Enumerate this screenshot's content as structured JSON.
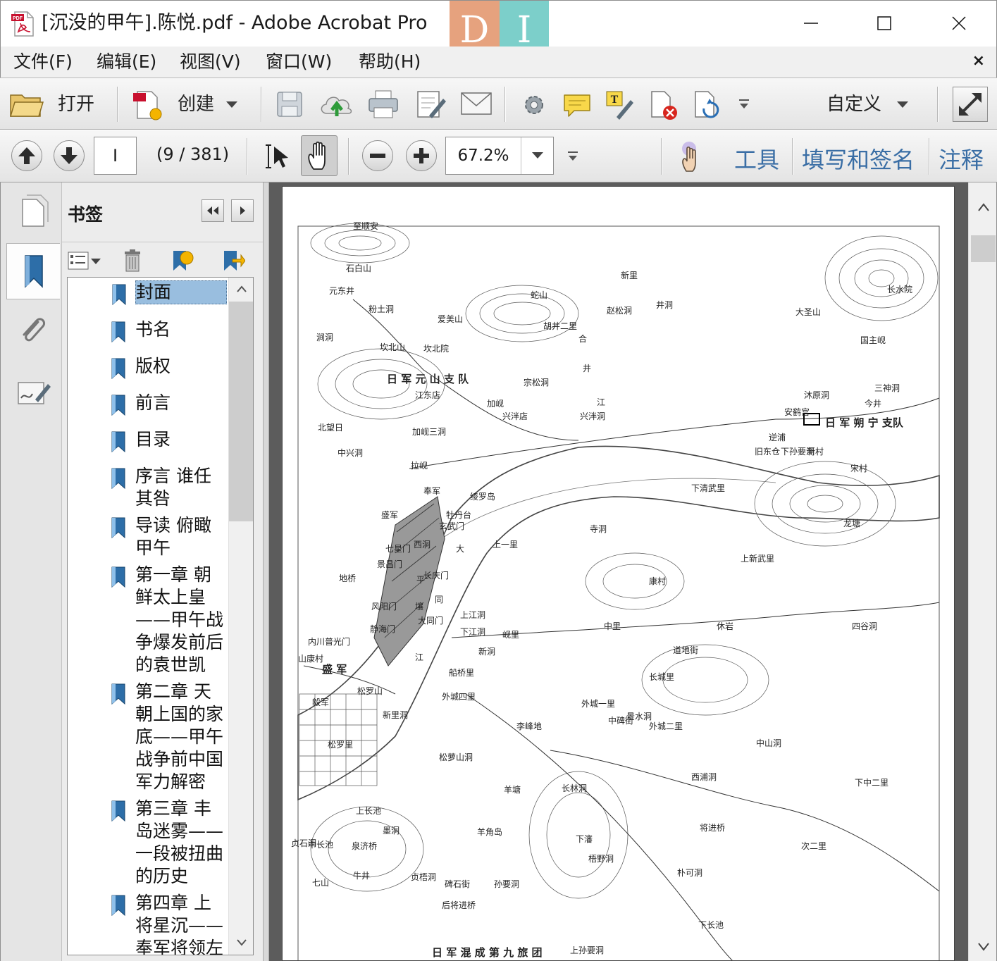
{
  "window": {
    "title": "[沉没的甲午].陈悦.pdf - Adobe Acrobat Pro",
    "icon": "pdf-file-icon",
    "brand_badge": [
      "D",
      "I"
    ],
    "controls": {
      "minimize": "minimize-icon",
      "maximize": "maximize-icon",
      "close": "close-icon"
    }
  },
  "menu": {
    "items": [
      "文件(F)",
      "编辑(E)",
      "视图(V)",
      "窗口(W)",
      "帮助(H)"
    ],
    "close_glyph": "×"
  },
  "toolbar": {
    "open_label": "打开",
    "create_label": "创建",
    "customize_label": "自定义",
    "icons": [
      "folder-icon",
      "create-pdf-icon",
      "save-icon",
      "upload-cloud-icon",
      "print-icon",
      "edit-document-icon",
      "email-icon",
      "gear-icon",
      "comment-icon",
      "text-edit-icon",
      "delete-page-icon",
      "page-rotate-icon",
      "more-icon",
      "expand-icon"
    ]
  },
  "nav_toolbar": {
    "page_value": "I",
    "page_count": "(9 / 381)",
    "zoom_value": "67.2%",
    "links": [
      "工具",
      "填写和签名",
      "注释"
    ],
    "icons": [
      "arrow-up-icon",
      "arrow-down-icon",
      "select-cursor-icon",
      "hand-tool-icon",
      "zoom-out-icon",
      "zoom-in-icon",
      "touch-read-icon"
    ]
  },
  "sidebar": {
    "rail_icons": [
      "page-thumbnails-icon",
      "bookmarks-icon",
      "attachment-icon",
      "signature-icon"
    ]
  },
  "bookmarks": {
    "title": "书签",
    "selected_index": 0,
    "items": [
      {
        "label": "封面"
      },
      {
        "label": "书名"
      },
      {
        "label": "版权"
      },
      {
        "label": "前言"
      },
      {
        "label": "目录"
      },
      {
        "label": "序言  谁任其咎"
      },
      {
        "label": "导读  俯瞰甲午"
      },
      {
        "label": "第一章  朝鲜太上皇——甲午战争爆发前后的袁世凯"
      },
      {
        "label": "第二章  天朝上国的家底——甲午战争前中国军力解密"
      },
      {
        "label": "第三章  丰岛迷雾——一段被扭曲的历史"
      },
      {
        "label": "第四章  上将星沉——奉军将领左"
      }
    ]
  },
  "map": {
    "labels": [
      "至顺安",
      "石白山",
      "元东井",
      "粉土洞",
      "爱美山",
      "蛇山",
      "新里",
      "赵松洞",
      "井洞",
      "长水院",
      "大圣山",
      "涧洞",
      "坎北山",
      "坎北院",
      "胡井二里",
      "合",
      "井",
      "江",
      "国主岘",
      "日 军 元 山 支 队",
      "宗松洞",
      "三神洞",
      "江东店",
      "加岘",
      "兴泮店",
      "兴泮洞",
      "沐原洞",
      "安鹤宫",
      "今井",
      "北望日",
      "加岘三洞",
      "中兴洞",
      "逆浦",
      "日 军 朔 宁 支队",
      "宋村",
      "拉岘",
      "奉军",
      "绫罗岛",
      "下清武里",
      "盛军",
      "牡丹台",
      "玄武门",
      "寺洞",
      "龙塘",
      "七星门",
      "西洞",
      "大",
      "上一里",
      "景昌门",
      "平",
      "壤",
      "长庆门",
      "同",
      "上新武里",
      "康村",
      "地桥",
      "风阳门",
      "上江洞",
      "静海门",
      "大同门",
      "下江洞",
      "岘里",
      "中里",
      "休岩",
      "四谷洞",
      "内川",
      "普光门",
      "新洞",
      "道地街",
      "山康村",
      "盛 军",
      "江",
      "船桥里",
      "长城里",
      "松罗山",
      "毅军",
      "新里洞",
      "外城四里",
      "外城一里",
      "中碑街",
      "景水洞",
      "松罗里",
      "李峰地",
      "外城二里",
      "中山洞",
      "松萝山洞",
      "羊塘",
      "长林洞",
      "西浦洞",
      "下中二里",
      "上长池",
      "墨洞",
      "羊角岛",
      "泉济桥",
      "将进桥",
      "贞石洞",
      "中长池",
      "下瀋",
      "梧野洞",
      "次二里",
      "七山",
      "牛井",
      "贞梧洞",
      "碑石街",
      "孙要洞",
      "朴可洞",
      "后将进桥",
      "下长池",
      "日 军 混 成 第 九 旅 团",
      "上孙要洞",
      "旧东仓",
      "下孙要洞",
      "新村"
    ]
  },
  "colors": {
    "link_blue": "#3a6ea5",
    "selection_blue": "#99bedf",
    "toolbar_bg": "#e8e8e8",
    "document_bg": "#5c5c5c"
  }
}
